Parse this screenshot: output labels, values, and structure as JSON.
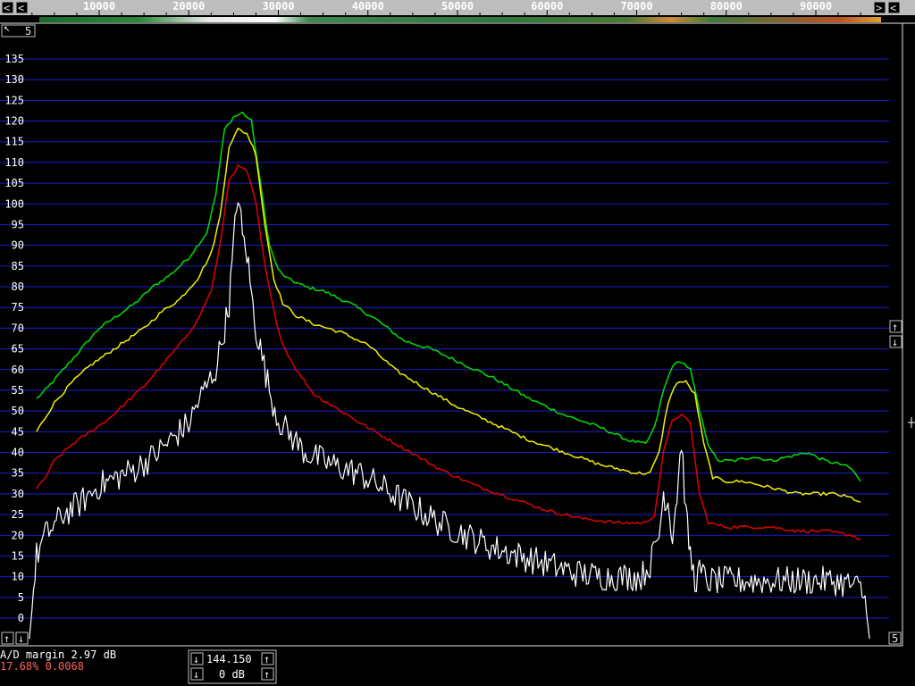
{
  "chart_data": {
    "type": "line",
    "x_ticks": [
      "10000",
      "20000",
      "30000",
      "40000",
      "50000",
      "60000",
      "70000",
      "80000",
      "90000"
    ],
    "y_ticks": [
      "135",
      "130",
      "125",
      "120",
      "115",
      "110",
      "105",
      "100",
      "95",
      "90",
      "85",
      "80",
      "75",
      "70",
      "65",
      "60",
      "55",
      "50",
      "45",
      "40",
      "35",
      "30",
      "25",
      "20",
      "15",
      "10",
      "5",
      "0"
    ],
    "xlim": [
      2000,
      97000
    ],
    "ylim": [
      -5,
      138
    ],
    "grid": true,
    "series": [
      {
        "color": "#00e000",
        "width": 1.5,
        "points": [
          [
            3000,
            53
          ],
          [
            4000,
            55
          ],
          [
            6000,
            60
          ],
          [
            8000,
            65
          ],
          [
            10000,
            70
          ],
          [
            12000,
            73
          ],
          [
            14000,
            76
          ],
          [
            16000,
            80
          ],
          [
            18000,
            83
          ],
          [
            20000,
            87
          ],
          [
            22000,
            93
          ],
          [
            23000,
            102
          ],
          [
            24000,
            118
          ],
          [
            25000,
            121
          ],
          [
            26000,
            122
          ],
          [
            27000,
            120
          ],
          [
            28000,
            105
          ],
          [
            29000,
            90
          ],
          [
            30000,
            84
          ],
          [
            31000,
            82
          ],
          [
            33000,
            80
          ],
          [
            35000,
            79
          ],
          [
            38000,
            76
          ],
          [
            41000,
            72
          ],
          [
            44000,
            67
          ],
          [
            47000,
            65
          ],
          [
            50000,
            62
          ],
          [
            54000,
            58
          ],
          [
            58000,
            53
          ],
          [
            62000,
            49
          ],
          [
            66000,
            46
          ],
          [
            69000,
            43
          ],
          [
            71000,
            42
          ],
          [
            72000,
            46
          ],
          [
            73000,
            55
          ],
          [
            74000,
            61
          ],
          [
            75000,
            62
          ],
          [
            76000,
            60
          ],
          [
            77000,
            50
          ],
          [
            78000,
            42
          ],
          [
            79000,
            38
          ],
          [
            81000,
            38
          ],
          [
            83000,
            39
          ],
          [
            85000,
            38
          ],
          [
            87000,
            39
          ],
          [
            89000,
            40
          ],
          [
            91000,
            38
          ],
          [
            93000,
            37
          ],
          [
            94000,
            36
          ],
          [
            95000,
            33
          ]
        ]
      },
      {
        "color": "#f0f000",
        "width": 1.5,
        "points": [
          [
            3000,
            45
          ],
          [
            5000,
            52
          ],
          [
            7000,
            57
          ],
          [
            9000,
            61
          ],
          [
            11000,
            64
          ],
          [
            13000,
            67
          ],
          [
            15000,
            70
          ],
          [
            17000,
            74
          ],
          [
            19000,
            77
          ],
          [
            21000,
            82
          ],
          [
            22500,
            88
          ],
          [
            23500,
            97
          ],
          [
            24500,
            114
          ],
          [
            25500,
            118
          ],
          [
            26500,
            117
          ],
          [
            27500,
            112
          ],
          [
            28500,
            95
          ],
          [
            29500,
            82
          ],
          [
            30500,
            76
          ],
          [
            32000,
            73
          ],
          [
            34000,
            71
          ],
          [
            37000,
            69
          ],
          [
            40000,
            66
          ],
          [
            43000,
            60
          ],
          [
            46000,
            56
          ],
          [
            50000,
            51
          ],
          [
            54000,
            47
          ],
          [
            58000,
            43
          ],
          [
            62000,
            40
          ],
          [
            66000,
            37
          ],
          [
            70000,
            35
          ],
          [
            71500,
            35
          ],
          [
            72500,
            40
          ],
          [
            73500,
            52
          ],
          [
            74500,
            57
          ],
          [
            75500,
            57
          ],
          [
            76500,
            54
          ],
          [
            77500,
            42
          ],
          [
            78500,
            34
          ],
          [
            80000,
            33
          ],
          [
            82000,
            33
          ],
          [
            84000,
            32
          ],
          [
            86000,
            31
          ],
          [
            88000,
            30
          ],
          [
            90000,
            30
          ],
          [
            92000,
            30
          ],
          [
            94000,
            29
          ],
          [
            95000,
            28
          ]
        ]
      },
      {
        "color": "#e00000",
        "width": 1.5,
        "points": [
          [
            3000,
            31
          ],
          [
            4000,
            34
          ],
          [
            5000,
            38
          ],
          [
            7000,
            42
          ],
          [
            9000,
            45
          ],
          [
            11000,
            48
          ],
          [
            13000,
            52
          ],
          [
            15000,
            56
          ],
          [
            17000,
            61
          ],
          [
            19000,
            66
          ],
          [
            21000,
            72
          ],
          [
            22500,
            79
          ],
          [
            23500,
            90
          ],
          [
            24500,
            106
          ],
          [
            25500,
            109
          ],
          [
            26500,
            108
          ],
          [
            27500,
            100
          ],
          [
            28500,
            85
          ],
          [
            29500,
            74
          ],
          [
            30500,
            66
          ],
          [
            32000,
            60
          ],
          [
            34000,
            54
          ],
          [
            37000,
            50
          ],
          [
            40000,
            46
          ],
          [
            44000,
            41
          ],
          [
            48000,
            36
          ],
          [
            52000,
            32
          ],
          [
            56000,
            29
          ],
          [
            60000,
            26
          ],
          [
            64000,
            24
          ],
          [
            68000,
            23
          ],
          [
            71000,
            23
          ],
          [
            72000,
            25
          ],
          [
            73000,
            40
          ],
          [
            74000,
            48
          ],
          [
            75000,
            49
          ],
          [
            76000,
            47
          ],
          [
            77000,
            30
          ],
          [
            78000,
            23
          ],
          [
            80000,
            22
          ],
          [
            83000,
            22
          ],
          [
            85000,
            22
          ],
          [
            88000,
            21
          ],
          [
            91000,
            21
          ],
          [
            94000,
            20
          ],
          [
            95000,
            19
          ]
        ]
      },
      {
        "color": "#ffffff",
        "width": 1.2,
        "noise": 3.5,
        "points": [
          [
            2200,
            -5
          ],
          [
            2500,
            2
          ],
          [
            3000,
            15
          ],
          [
            4000,
            20
          ],
          [
            6000,
            25
          ],
          [
            8000,
            28
          ],
          [
            10000,
            32
          ],
          [
            12000,
            34
          ],
          [
            14000,
            36
          ],
          [
            16000,
            39
          ],
          [
            18000,
            43
          ],
          [
            20000,
            47
          ],
          [
            21000,
            52
          ],
          [
            22000,
            56
          ],
          [
            23000,
            60
          ],
          [
            24000,
            70
          ],
          [
            24500,
            76
          ],
          [
            25000,
            90
          ],
          [
            25500,
            103
          ],
          [
            26000,
            92
          ],
          [
            26500,
            88
          ],
          [
            27000,
            78
          ],
          [
            27500,
            70
          ],
          [
            28000,
            65
          ],
          [
            29000,
            55
          ],
          [
            30000,
            48
          ],
          [
            31000,
            45
          ],
          [
            33000,
            40
          ],
          [
            36000,
            37
          ],
          [
            39000,
            35
          ],
          [
            42000,
            31
          ],
          [
            45000,
            27
          ],
          [
            48000,
            23
          ],
          [
            51000,
            20
          ],
          [
            54000,
            17
          ],
          [
            57000,
            15
          ],
          [
            60000,
            13
          ],
          [
            63000,
            11
          ],
          [
            66000,
            10
          ],
          [
            69000,
            10
          ],
          [
            70500,
            10
          ],
          [
            71500,
            13
          ],
          [
            72500,
            20
          ],
          [
            73000,
            30
          ],
          [
            73500,
            28
          ],
          [
            74000,
            20
          ],
          [
            74500,
            30
          ],
          [
            75000,
            43
          ],
          [
            75500,
            25
          ],
          [
            76000,
            15
          ],
          [
            76500,
            9
          ],
          [
            77000,
            11
          ],
          [
            78000,
            9
          ],
          [
            80000,
            9
          ],
          [
            83000,
            9
          ],
          [
            86000,
            9
          ],
          [
            89000,
            9
          ],
          [
            92000,
            9
          ],
          [
            94000,
            8
          ],
          [
            95000,
            7
          ],
          [
            95500,
            4
          ],
          [
            96000,
            -5
          ]
        ]
      }
    ]
  },
  "status": {
    "ad_margin": "A/D margin  2.97 dB",
    "percent": "17.68% 0.0068"
  },
  "controls": {
    "freq_value": "144.150",
    "gain_value": "0 dB",
    "btn_top_left": "5",
    "btn_bottom_right": "5",
    "icon_corner": "↖"
  },
  "colors": {
    "grid": "#1c1ccc",
    "frame": "#e6e6e6",
    "green": "#00e000",
    "yellow": "#f0f000",
    "red": "#e00000",
    "white": "#ffffff"
  }
}
